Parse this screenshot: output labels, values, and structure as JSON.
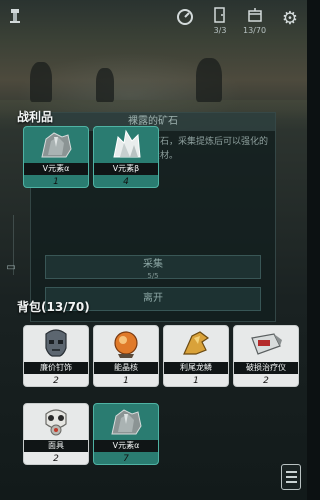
{
  "hud": {
    "left_icon": "lamp-icon",
    "btn1_icon": "gauge-icon",
    "btn2_icon": "door-icon",
    "btn2_count": "3/3",
    "btn3_icon": "crate-icon",
    "btn3_count": "13/70",
    "btn4_icon": "gear-icon"
  },
  "background_dialog": {
    "title": "裸露的矿石",
    "description": "矿石，采集提炼后可以强化的素材。",
    "collect_label": "采集",
    "collect_sub": "5/5",
    "leave_label": "离开"
  },
  "loot": {
    "title": "战利品",
    "items": [
      {
        "name": "V元素α",
        "qty": "1",
        "icon": "grey-ore-icon",
        "rarity": "teal"
      },
      {
        "name": "V元素β",
        "qty": "4",
        "icon": "white-crystal-icon",
        "rarity": "teal"
      }
    ]
  },
  "bag": {
    "title": "背包(13/70)",
    "items": [
      {
        "name": "廉价钉饰",
        "qty": "2",
        "icon": "skull-mask-icon",
        "rarity": "white"
      },
      {
        "name": "能晶核",
        "qty": "1",
        "icon": "orange-core-icon",
        "rarity": "white"
      },
      {
        "name": "利尾龙鳞",
        "qty": "1",
        "icon": "golden-claw-icon",
        "rarity": "white"
      },
      {
        "name": "破损治疗仪",
        "qty": "2",
        "icon": "broken-device-icon",
        "rarity": "white"
      },
      {
        "name": "面具",
        "qty": "2",
        "icon": "gas-mask-icon",
        "rarity": "white"
      },
      {
        "name": "V元素α",
        "qty": "7",
        "icon": "grey-ore-icon",
        "rarity": "teal"
      }
    ]
  },
  "menu_icon": "menu-icon"
}
